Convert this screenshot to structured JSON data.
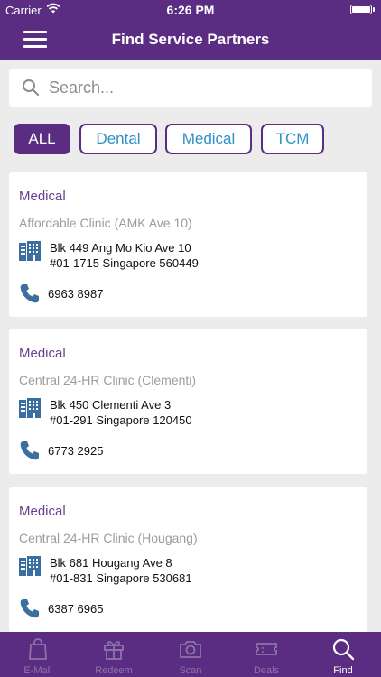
{
  "status_bar": {
    "carrier": "Carrier",
    "time": "6:26 PM"
  },
  "header": {
    "title": "Find Service Partners",
    "menu_icon": "hamburger-menu-icon"
  },
  "search": {
    "placeholder": "Search...",
    "value": ""
  },
  "filters": [
    {
      "label": "ALL",
      "active": true
    },
    {
      "label": "Dental",
      "active": false
    },
    {
      "label": "Medical",
      "active": false
    },
    {
      "label": "TCM",
      "active": false
    }
  ],
  "partners": [
    {
      "category": "Medical",
      "name": "Affordable Clinic (AMK Ave 10)",
      "address_line1": "Blk 449 Ang Mo Kio Ave 10",
      "address_line2": "#01-1715 Singapore 560449",
      "phone": "6963 8987"
    },
    {
      "category": "Medical",
      "name": "Central 24-HR Clinic (Clementi)",
      "address_line1": "Blk 450 Clementi Ave 3",
      "address_line2": "#01-291 Singapore 120450",
      "phone": "6773 2925"
    },
    {
      "category": "Medical",
      "name": "Central 24-HR Clinic (Hougang)",
      "address_line1": "Blk 681 Hougang Ave 8",
      "address_line2": "#01-831 Singapore 530681",
      "phone": "6387 6965"
    }
  ],
  "tabs": [
    {
      "label": "E-Mall",
      "icon": "shopping-bag-icon",
      "active": false
    },
    {
      "label": "Redeem",
      "icon": "gift-icon",
      "active": false
    },
    {
      "label": "Scan",
      "icon": "camera-icon",
      "active": false
    },
    {
      "label": "Deals",
      "icon": "ticket-icon",
      "active": false
    },
    {
      "label": "Find",
      "icon": "search-icon",
      "active": true
    }
  ],
  "colors": {
    "brand": "#5a2d82",
    "link": "#2f8fc9",
    "icon_blue": "#3b6fa0",
    "category": "#6a3e91"
  }
}
